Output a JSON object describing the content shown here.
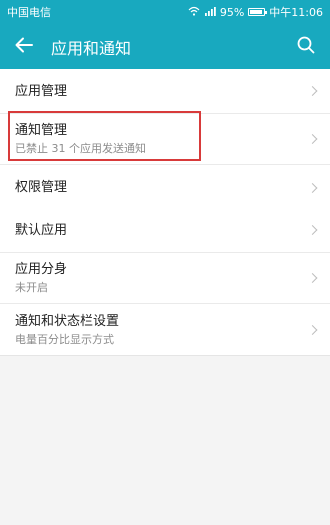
{
  "status_bar": {
    "carrier": "中国电信",
    "battery": "95%",
    "battery_level": 0.95,
    "time": "中午11:06"
  },
  "header": {
    "title": "应用和通知"
  },
  "group1": {
    "items": [
      {
        "title": "应用管理",
        "subtitle": ""
      },
      {
        "title": "通知管理",
        "subtitle": "已禁止 31 个应用发送通知"
      },
      {
        "title": "权限管理",
        "subtitle": ""
      }
    ]
  },
  "group2": {
    "items": [
      {
        "title": "默认应用",
        "subtitle": ""
      },
      {
        "title": "应用分身",
        "subtitle": "未开启"
      },
      {
        "title": "通知和状态栏设置",
        "subtitle": "电量百分比显示方式"
      }
    ]
  },
  "colors": {
    "accent": "#18a9bf",
    "highlight": "#d83a3a"
  }
}
